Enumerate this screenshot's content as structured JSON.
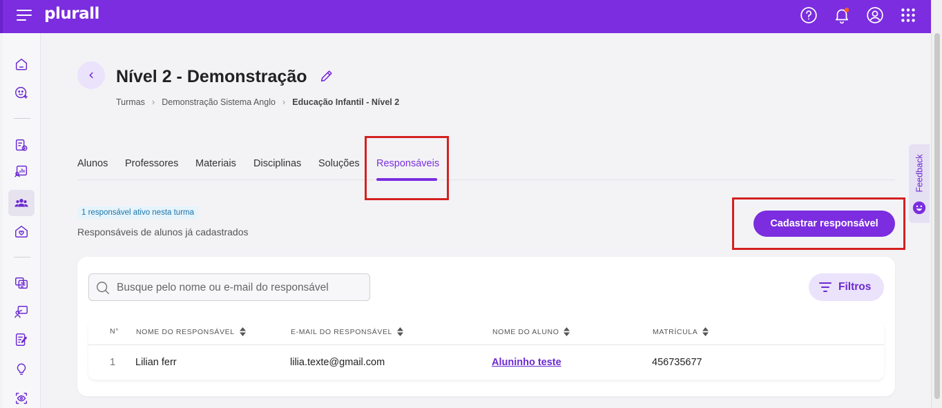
{
  "app": {
    "logo_text": "plurall",
    "brand_color": "#7b2ddf",
    "header_icons": [
      "help-icon",
      "notification-bell-icon",
      "user-profile-icon",
      "apps-grid-icon"
    ],
    "notification_dot_color": "#ff5a1f"
  },
  "sidebar": {
    "items": [
      {
        "icon": "home-icon"
      },
      {
        "icon": "ai-assistant-icon"
      },
      {
        "icon": "assessments-icon"
      },
      {
        "icon": "reports-icon"
      },
      {
        "icon": "classes-icon",
        "active": true
      },
      {
        "icon": "family-home-icon"
      },
      {
        "icon": "content-library-icon"
      },
      {
        "icon": "teacher-presentation-icon"
      },
      {
        "icon": "activities-icon"
      },
      {
        "icon": "ideas-icon"
      },
      {
        "icon": "monitoring-icon"
      }
    ]
  },
  "page": {
    "title": "Nível 2 - Demonstração",
    "breadcrumb": [
      "Turmas",
      "Demonstração Sistema Anglo",
      "Educação Infantil - Nível 2"
    ]
  },
  "tabs": [
    "Alunos",
    "Professores",
    "Materiais",
    "Disciplinas",
    "Soluções",
    "Responsáveis"
  ],
  "active_tab": "Responsáveis",
  "responsaveis": {
    "active_badge": "1 responsável ativo nesta turma",
    "subtitle": "Responsáveis de alunos já cadastrados",
    "add_button_label": "Cadastrar responsável",
    "search_placeholder": "Busque pelo nome ou e-mail do responsável",
    "filter_label": "Filtros"
  },
  "table": {
    "columns": [
      "N°",
      "NOME DO RESPONSÁVEL",
      "E-MAIL DO RESPONSÁVEL",
      "NOME DO ALUNO",
      "MATRÍCULA"
    ],
    "rows": [
      {
        "n": "1",
        "nome": "Lilian ferr",
        "email": "lilia.texte@gmail.com",
        "aluno": "Aluninho teste",
        "matricula": "456735677"
      }
    ]
  },
  "feedback_label": "Feedback",
  "highlight_color": "#d42020"
}
